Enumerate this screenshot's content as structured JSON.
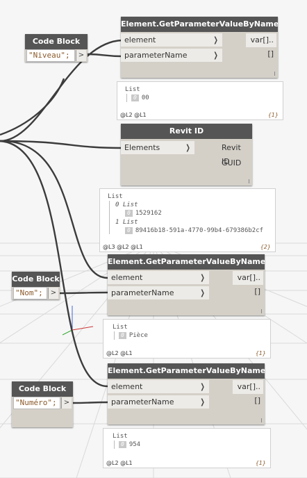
{
  "colors": {
    "header": "#555555",
    "body": "#d4d0c8",
    "port": "#edebe7",
    "wire": "#3c3c3c",
    "canvas": "#f6f6f6"
  },
  "codeblocks": {
    "niveau": {
      "title": "Code Block",
      "code": "\"Niveau\";",
      "out": ">"
    },
    "nom": {
      "title": "Code Block",
      "code": "\"Nom\";",
      "out": ">"
    },
    "numero": {
      "title": "Code Block",
      "code": "\"Numéro\";",
      "out": ">"
    }
  },
  "getparam1": {
    "title": "Element.GetParameterValueByName",
    "in1": "element",
    "in2": "parameterName",
    "out": "var[]..[]"
  },
  "getparam2": {
    "title": "Element.GetParameterValueByName",
    "in1": "element",
    "in2": "parameterName",
    "out": "var[]..[]"
  },
  "getparam3": {
    "title": "Element.GetParameterValueByName",
    "in1": "element",
    "in2": "parameterName",
    "out": "var[]..[]"
  },
  "revitid": {
    "title": "Revit ID",
    "in1": "Elements",
    "out1": "Revit ID",
    "out2": "GUID"
  },
  "preview1": {
    "list": "List",
    "i0": "0",
    "v0": "00",
    "levels": "@L2 @L1",
    "count": "{1}"
  },
  "preview2": {
    "list": "List",
    "sub0": "0 List",
    "i0": "0",
    "v0": "1529162",
    "sub1": "1 List",
    "i1": "0",
    "v1": "89416b18-591a-4770-99b4-679386b2cf",
    "levels": "@L3 @L2 @L1",
    "count": "{2}"
  },
  "preview3": {
    "list": "List",
    "i0": "0",
    "v0": "Pièce",
    "levels": "@L2 @L1",
    "count": "{1}"
  },
  "preview4": {
    "list": "List",
    "i0": "0",
    "v0": "954",
    "levels": "@L2 @L1",
    "count": "{1}"
  },
  "icons": {
    "arrow": "chevron-right",
    "tree": "tree-line"
  }
}
